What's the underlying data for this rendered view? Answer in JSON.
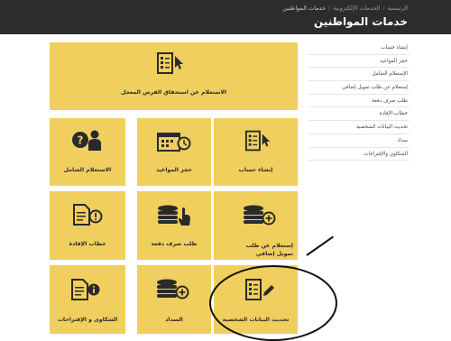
{
  "header": {
    "breadcrumb": [
      "الرئيسية",
      "الخدمات الإلكترونية",
      "خدمات المواطنين"
    ],
    "title": "خدمات المواطنين"
  },
  "sidebar": {
    "items": [
      {
        "label": "إنشاء حساب"
      },
      {
        "label": "حجز المواعيد"
      },
      {
        "label": "الإستعلام الشامل"
      },
      {
        "label": "إستعلام عن طلب تمويل إضافي"
      },
      {
        "label": "طلب صرف دفعة"
      },
      {
        "label": "خطاب الإفادة"
      },
      {
        "label": "تحديث البيانات الشخصية"
      },
      {
        "label": "سداد"
      },
      {
        "label": "الشكاوي والإقتراحات"
      }
    ]
  },
  "tiles": [
    {
      "label": "الاستعلام عن استحقاق القرض المعجل",
      "icon": "document-pointer-icon"
    },
    {
      "label": "إنشاء حساب",
      "icon": "document-pointer-icon"
    },
    {
      "label": "حجز المواعيد",
      "icon": "calendar-clock-icon"
    },
    {
      "label": "الاستعلام الشامل",
      "icon": "question-person-icon"
    },
    {
      "label": "إستعلام عن طلب تمويل إضافي",
      "icon": "coins-plus-icon"
    },
    {
      "label": "طلب صرف دفعة",
      "icon": "coins-hand-icon"
    },
    {
      "label": "خطاب الإفادة",
      "icon": "document-alert-icon"
    },
    {
      "label": "تحديث البيانات الشخصية",
      "icon": "document-pen-icon"
    },
    {
      "label": "السداد",
      "icon": "coins-plus-icon"
    },
    {
      "label": "الشكاوى و الإقتراحات",
      "icon": "document-info-icon"
    }
  ],
  "colors": {
    "tile": "#f0cf5e",
    "topbar": "#2c2c2c",
    "icon": "#2a2a2a"
  }
}
